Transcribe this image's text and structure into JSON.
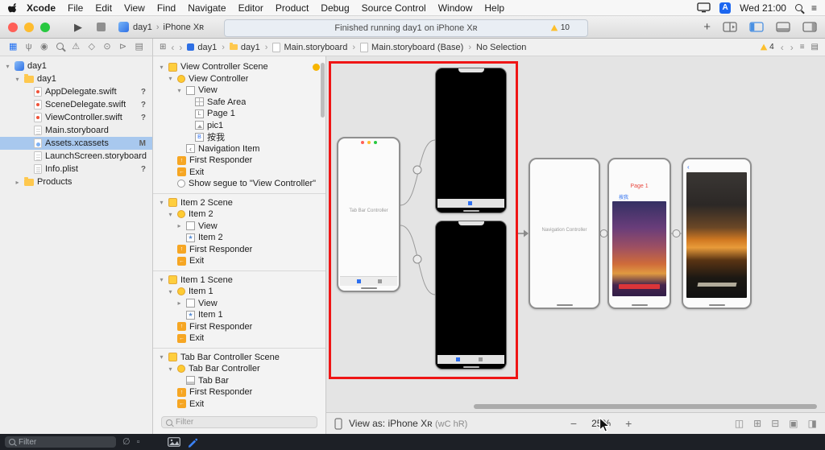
{
  "colors": {
    "accent_blue": "#1f6ff2",
    "selection_blue": "#a8c8ee",
    "warning_yellow": "#f7b500",
    "highlight_red": "#ef1515"
  },
  "menubar": {
    "items": [
      "Xcode",
      "File",
      "Edit",
      "View",
      "Find",
      "Navigate",
      "Editor",
      "Product",
      "Debug",
      "Source Control",
      "Window",
      "Help"
    ],
    "input_badge": "A",
    "clock": "Wed 21:00"
  },
  "toolbar": {
    "scheme_target": "day1",
    "scheme_device": "iPhone Xʀ",
    "status": "Finished running day1 on iPhone Xʀ",
    "warning_count": "10"
  },
  "jumpbar": {
    "crumbs": [
      {
        "label": "day1",
        "icon": "app"
      },
      {
        "label": "day1",
        "icon": "folder"
      },
      {
        "label": "Main.storyboard",
        "icon": "doc"
      },
      {
        "label": "Main.storyboard (Base)",
        "icon": "doc"
      },
      {
        "label": "No Selection",
        "icon": ""
      }
    ],
    "warning_count": "4"
  },
  "navigator": {
    "filter_placeholder": "Filter",
    "files": [
      {
        "label": "day1",
        "depth": 0,
        "icon": "project",
        "disclosure": "open",
        "badge": ""
      },
      {
        "label": "day1",
        "depth": 1,
        "icon": "folder",
        "disclosure": "open",
        "badge": ""
      },
      {
        "label": "AppDelegate.swift",
        "depth": 2,
        "icon": "swift",
        "disclosure": "",
        "badge": "?"
      },
      {
        "label": "SceneDelegate.swift",
        "depth": 2,
        "icon": "swift",
        "disclosure": "",
        "badge": "?"
      },
      {
        "label": "ViewController.swift",
        "depth": 2,
        "icon": "swift",
        "disclosure": "",
        "badge": "?"
      },
      {
        "label": "Main.storyboard",
        "depth": 2,
        "icon": "storyboard",
        "disclosure": "",
        "badge": ""
      },
      {
        "label": "Assets.xcassets",
        "depth": 2,
        "icon": "assets",
        "disclosure": "",
        "badge": "M",
        "selected": true
      },
      {
        "label": "LaunchScreen.storyboard",
        "depth": 2,
        "icon": "storyboard",
        "disclosure": "",
        "badge": ""
      },
      {
        "label": "Info.plist",
        "depth": 2,
        "icon": "plist",
        "disclosure": "",
        "badge": "?"
      },
      {
        "label": "Products",
        "depth": 1,
        "icon": "folder-closed",
        "disclosure": "closed",
        "badge": ""
      }
    ]
  },
  "outline": {
    "filter_placeholder": "Filter",
    "sections": [
      {
        "rows": [
          {
            "label": "View Controller Scene",
            "depth": 0,
            "icon": "scene",
            "disclosure": "open",
            "warn": true
          },
          {
            "label": "View Controller",
            "depth": 1,
            "icon": "vc",
            "disclosure": "open"
          },
          {
            "label": "View",
            "depth": 2,
            "icon": "view",
            "disclosure": "open"
          },
          {
            "label": "Safe Area",
            "depth": 3,
            "icon": "safearea"
          },
          {
            "label": "Page 1",
            "depth": 3,
            "icon": "label"
          },
          {
            "label": "pic1",
            "depth": 3,
            "icon": "imageview"
          },
          {
            "label": "按我",
            "depth": 3,
            "icon": "button"
          },
          {
            "label": "Navigation Item",
            "depth": 2,
            "icon": "navitem"
          },
          {
            "label": "First Responder",
            "depth": 1,
            "icon": "firstresponder"
          },
          {
            "label": "Exit",
            "depth": 1,
            "icon": "exit"
          },
          {
            "label": "Show segue to \"View Controller\"",
            "depth": 1,
            "icon": "segue"
          }
        ]
      },
      {
        "rows": [
          {
            "label": "Item 2 Scene",
            "depth": 0,
            "icon": "scene",
            "disclosure": "open"
          },
          {
            "label": "Item 2",
            "depth": 1,
            "icon": "vc",
            "disclosure": "open"
          },
          {
            "label": "View",
            "depth": 2,
            "icon": "view",
            "disclosure": "closed"
          },
          {
            "label": "Item 2",
            "depth": 2,
            "icon": "tabitem"
          },
          {
            "label": "First Responder",
            "depth": 1,
            "icon": "firstresponder"
          },
          {
            "label": "Exit",
            "depth": 1,
            "icon": "exit"
          }
        ]
      },
      {
        "rows": [
          {
            "label": "Item 1 Scene",
            "depth": 0,
            "icon": "scene",
            "disclosure": "open"
          },
          {
            "label": "Item 1",
            "depth": 1,
            "icon": "vc",
            "disclosure": "open"
          },
          {
            "label": "View",
            "depth": 2,
            "icon": "view",
            "disclosure": "closed"
          },
          {
            "label": "Item 1",
            "depth": 2,
            "icon": "tabitem"
          },
          {
            "label": "First Responder",
            "depth": 1,
            "icon": "firstresponder"
          },
          {
            "label": "Exit",
            "depth": 1,
            "icon": "exit"
          }
        ]
      },
      {
        "rows": [
          {
            "label": "Tab Bar Controller Scene",
            "depth": 0,
            "icon": "scene",
            "disclosure": "open"
          },
          {
            "label": "Tab Bar Controller",
            "depth": 1,
            "icon": "vc",
            "disclosure": "open"
          },
          {
            "label": "Tab Bar",
            "depth": 2,
            "icon": "tabbar"
          },
          {
            "label": "First Responder",
            "depth": 1,
            "icon": "firstresponder"
          },
          {
            "label": "Exit",
            "depth": 1,
            "icon": "exit"
          }
        ]
      }
    ]
  },
  "canvas": {
    "tab_bar_controller_label": "Tab Bar Controller",
    "navigation_controller_label": "Navigation Controller",
    "page_title": "Page 1",
    "page_button": "按我",
    "back_label": "‹",
    "view_as_label": "View as: iPhone Xʀ",
    "traits": "(wC hR)",
    "zoom": "25%"
  },
  "icons": {
    "navigator_tabs": [
      {
        "name": "project-navigator-icon",
        "glyph": "▦",
        "active": true
      },
      {
        "name": "source-control-navigator-icon",
        "glyph": "ψ"
      },
      {
        "name": "symbol-navigator-icon",
        "glyph": "◉"
      },
      {
        "name": "find-navigator-icon",
        "glyph": ""
      },
      {
        "name": "issue-navigator-icon",
        "glyph": "⚠"
      },
      {
        "name": "test-navigator-icon",
        "glyph": "◇"
      },
      {
        "name": "debug-navigator-icon",
        "glyph": "⊙"
      },
      {
        "name": "breakpoint-navigator-icon",
        "glyph": "⊳"
      },
      {
        "name": "report-navigator-icon",
        "glyph": "▤"
      }
    ],
    "canvas_tools": [
      {
        "name": "update-frames-icon",
        "glyph": "◫"
      },
      {
        "name": "embed-in-stack-icon",
        "glyph": "⊞"
      },
      {
        "name": "align-icon",
        "glyph": "⊟"
      },
      {
        "name": "pin-icon",
        "glyph": "▣"
      },
      {
        "name": "resolve-auto-layout-icon",
        "glyph": "◨"
      }
    ],
    "bottom_left_tools": [
      {
        "name": "no-recent-filter-icon",
        "glyph": "∅"
      },
      {
        "name": "source-control-filter-icon",
        "glyph": "▫"
      }
    ]
  }
}
